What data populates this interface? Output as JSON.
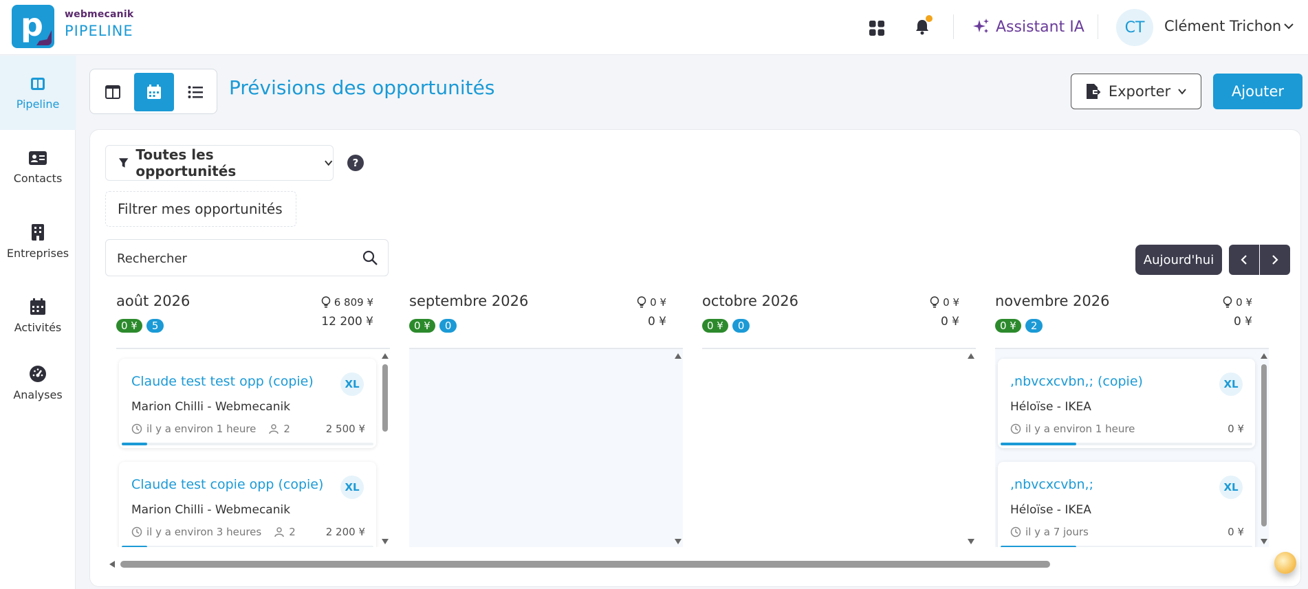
{
  "brand": {
    "name_top": "webmecanik",
    "name_bottom": "PIPELINE"
  },
  "header": {
    "assistant_label": "Assistant IA",
    "user_initials": "CT",
    "user_name": "Clément Trichon"
  },
  "sidebar": {
    "items": [
      {
        "label": "Pipeline",
        "icon": "pipeline-icon",
        "active": true
      },
      {
        "label": "Contacts",
        "icon": "contact-card-icon",
        "active": false
      },
      {
        "label": "Entreprises",
        "icon": "building-icon",
        "active": false
      },
      {
        "label": "Activités",
        "icon": "calendar-icon",
        "active": false
      },
      {
        "label": "Analyses",
        "icon": "gauge-icon",
        "active": false
      }
    ]
  },
  "toolbar": {
    "page_title": "Prévisions des opportunités",
    "export_label": "Exporter",
    "add_label": "Ajouter"
  },
  "filters": {
    "dropdown_label": "Toutes les opportunités",
    "help_glyph": "?",
    "mine_label": "Filtrer mes opportunités",
    "search_placeholder": "Rechercher",
    "today_label": "Aujourd'hui"
  },
  "columns": [
    {
      "month": "août 2026",
      "metric_potential": "6 809 ¥",
      "metric_total": "12 200 ¥",
      "pill_amount": "0 ¥",
      "pill_count": "5",
      "cards": [
        {
          "title": "Claude test test opp (copie)",
          "badge": "XL",
          "contact": "Marion Chilli - Webmecanik",
          "time": "il y a environ 1 heure",
          "users": "2",
          "amount": "2 500 ¥",
          "progress": 0.1
        },
        {
          "title": "Claude test copie opp (copie)",
          "badge": "XL",
          "contact": "Marion Chilli - Webmecanik",
          "time": "il y a environ 3 heures",
          "users": "2",
          "amount": "2 200 ¥",
          "progress": 0.1
        }
      ]
    },
    {
      "month": "septembre 2026",
      "metric_potential": "0 ¥",
      "metric_total": "0 ¥",
      "pill_amount": "0 ¥",
      "pill_count": "0",
      "cards": []
    },
    {
      "month": "octobre 2026",
      "metric_potential": "0 ¥",
      "metric_total": "0 ¥",
      "pill_amount": "0 ¥",
      "pill_count": "0",
      "cards": []
    },
    {
      "month": "novembre 2026",
      "metric_potential": "0 ¥",
      "metric_total": "0 ¥",
      "pill_amount": "0 ¥",
      "pill_count": "2",
      "cards": [
        {
          "title": ",nbvcxcvbn,; (copie)",
          "badge": "XL",
          "contact": "Héloïse - IKEA",
          "time": "il y a environ 1 heure",
          "users": "",
          "amount": "0 ¥",
          "progress": 0.3
        },
        {
          "title": ",nbvcxcvbn,;",
          "badge": "XL",
          "contact": "Héloïse - IKEA",
          "time": "il y a 7 jours",
          "users": "",
          "amount": "0 ¥",
          "progress": 0.3
        }
      ]
    }
  ],
  "colors": {
    "accent": "#1b9ad6",
    "brand_purple": "#5b2a6e",
    "pill_green": "#2c8a2c",
    "dark_button": "#3d3d4e"
  }
}
